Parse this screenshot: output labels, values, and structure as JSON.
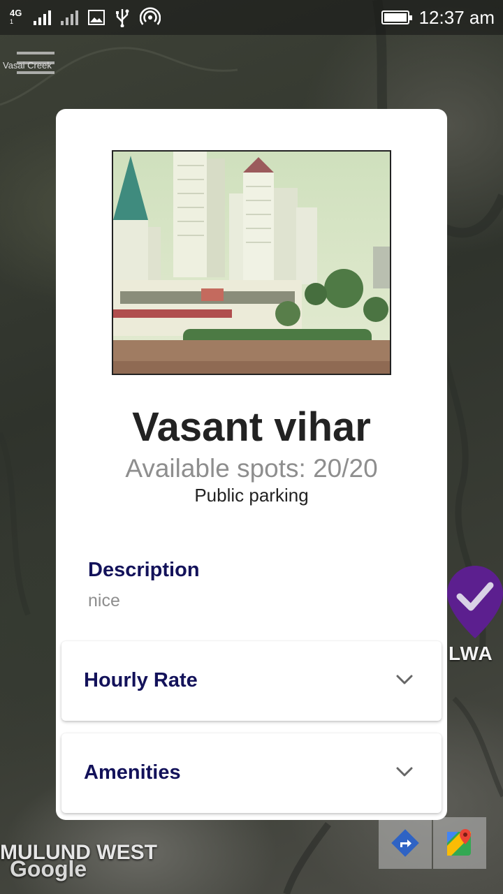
{
  "status_bar": {
    "network_type": "4G",
    "sim1_index": "1",
    "sim2_index": "2",
    "time": "12:37 am",
    "icons": [
      "signal-sim1-icon",
      "signal-sim2-icon",
      "image-notification-icon",
      "usb-icon",
      "hotspot-icon",
      "battery-charging-icon"
    ]
  },
  "map": {
    "top_label": "Vasai Creek",
    "area_label": "MULUND WEST",
    "logo_text": "Google",
    "pin_label": "LWA",
    "pin_color": "#5c1f8f",
    "buttons": [
      "directions-icon",
      "google-maps-icon"
    ]
  },
  "place": {
    "name": "Vasant vihar",
    "available_spots": "Available spots: 20/20",
    "parking_type": "Public parking",
    "description_heading": "Description",
    "description": "nice",
    "sections": [
      {
        "label": "Hourly Rate",
        "icon": "chevron-down-icon"
      },
      {
        "label": "Amenities",
        "icon": "chevron-down-icon"
      }
    ]
  },
  "colors": {
    "heading_navy": "#13125a",
    "muted_text": "#8e8e8e",
    "title_text": "#222222"
  }
}
